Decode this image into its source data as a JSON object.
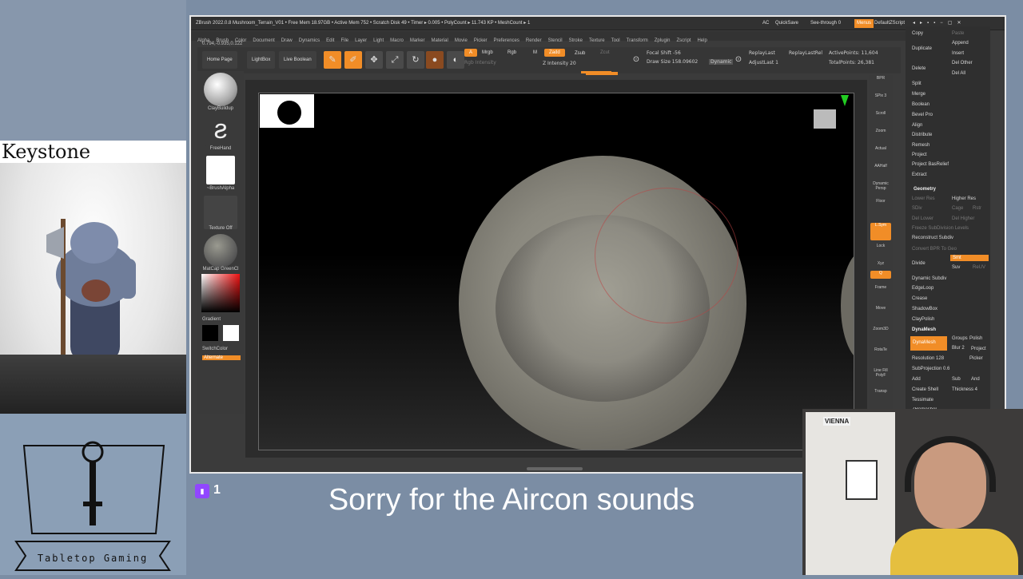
{
  "overlay": {
    "channel_title": "Keystone Guardian",
    "viewer_count": "1",
    "caption": "Sorry for the Aircon sounds",
    "logo_text": "Tabletop Gaming"
  },
  "zbrush": {
    "title_line": "ZBrush 2022.0.8   Mushroom_Terrain_V01   • Free Mem 18.97GB • Active Mem 752 • Scratch Disk 49 • Timer ▸ 0.005 • PolyCount ▸ 11.743 KP • MeshCount ▸ 1",
    "title_right": {
      "ac": "AC",
      "quicksave": "QuickSave",
      "seethrough": "See-through  0",
      "menus": "Menus",
      "script": "DefaultZScript"
    },
    "menu": [
      "Alpha",
      "Brush",
      "Color",
      "Document",
      "Draw",
      "Dynamics",
      "Edit",
      "File",
      "Layer",
      "Light",
      "Macro",
      "Marker",
      "Material",
      "Movie",
      "Picker",
      "Preferences",
      "Render",
      "Stencil",
      "Stroke",
      "Texture",
      "Tool",
      "Transform",
      "Zplugin",
      "Zscript",
      "Help"
    ],
    "coords": "0.794,-0.935,0.122",
    "shelf": {
      "home": "Home Page",
      "lightbox": "LightBox",
      "live_boolean": "Live Boolean",
      "edit": "Edit",
      "draw": "Draw",
      "move": "Move",
      "scale": "Scale",
      "rotate": "Rotate",
      "a": "A",
      "mrgb": "Mrgb",
      "rgb": "Rgb",
      "m": "M",
      "zadd": "Zadd",
      "zsub": "Zsub",
      "zcut": "Zcut",
      "rgb_intensity": "Rgb Intensity",
      "z_intensity": "Z Intensity 20",
      "focal_shift": "Focal Shift -56",
      "draw_size": "Draw Size 158.09602",
      "dynamic": "Dynamic",
      "replay_last": "ReplayLast",
      "replay_last_rel": "ReplayLastRel",
      "adjust_last": "AdjustLast 1",
      "active_points": "ActivePoints: 11,604",
      "total_points": "TotalPoints: 26,381"
    },
    "left_tray": {
      "brush": "ClayBuildup",
      "stroke": "FreeHand",
      "alpha": "~BrushAlpha",
      "texture": "Texture Off",
      "material": "MatCap GreenCl",
      "gradient": "Gradient",
      "switch_color": "SwitchColor",
      "alternate": "Alternate"
    },
    "right_tray": [
      "BPR",
      "SPix 3",
      "Scroll",
      "Zoom",
      "Actual",
      "AAHalf",
      "Dynamic Persp",
      "Floor",
      "L.Sym",
      "Lock",
      "Xyz",
      "Q",
      "Frame",
      "Move",
      "Zoom3D",
      "RotaTe",
      "Line Fill PolyF",
      "Transp"
    ],
    "right_menu": {
      "copy": "Copy",
      "paste": "Paste",
      "duplicate": "Duplicate",
      "append": "Append",
      "insert": "Insert",
      "delete": "Delete",
      "del_other": "Del Other",
      "del_all": "Del All",
      "split": "Split",
      "merge": "Merge",
      "boolean": "Boolean",
      "bevel_pro": "Bevel Pro",
      "align": "Align",
      "distribute": "Distribute",
      "remesh": "Remesh",
      "project": "Project",
      "project_basrelief": "Project BasRelief",
      "extract": "Extract",
      "geometry": "Geometry",
      "lower_res": "Lower Res",
      "higher_res": "Higher Res",
      "sdiv": "SDiv",
      "cage": "Cage",
      "rstr": "Rstr",
      "del_lower": "Del Lower",
      "del_higher": "Del Higher",
      "freeze_subdiv": "Freeze SubDivision Levels",
      "reconstruct_subdiv": "Reconstruct Subdiv",
      "convert_bpr": "Convert BPR To Geo",
      "divide": "Divide",
      "smt": "Smt",
      "suv": "Suv",
      "reuv": "ReUV",
      "dynamic_subdiv": "Dynamic Subdiv",
      "edgeloop": "EdgeLoop",
      "crease": "Crease",
      "shadowbox": "ShadowBox",
      "claypolish": "ClayPolish",
      "dynamesh_sec": "DynaMesh",
      "dynamesh_btn": "DynaMesh",
      "groups": "Groups",
      "polish": "Polish",
      "blur": "Blur 2",
      "project2": "Project",
      "resolution": "Resolution 128",
      "picker": "Picker",
      "subprojection": "SubProjection 0.6",
      "add": "Add",
      "sub": "Sub",
      "and": "And",
      "create_shell": "Create Shell",
      "thickness": "Thickness 4",
      "tessimate": "Tessimate",
      "zremesher": "ZRemesher"
    }
  },
  "webcam": {
    "sticker": "VIENNA"
  },
  "colors": {
    "accent": "#f18d27",
    "twitch": "#9146ff",
    "background": "#7b8da4"
  }
}
